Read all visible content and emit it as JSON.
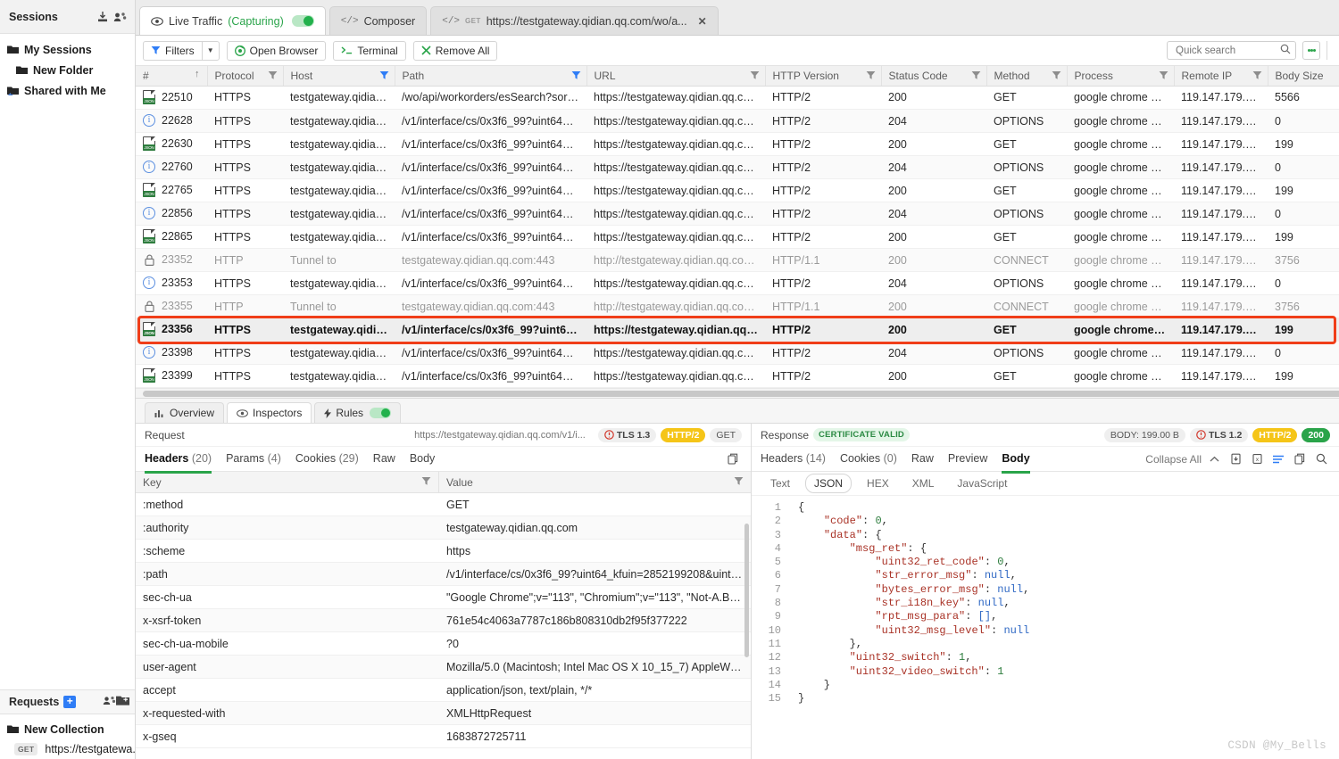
{
  "sidebar": {
    "header": {
      "title": "Sessions",
      "icons": [
        "import-icon",
        "manage-sessions-icon"
      ]
    },
    "items": [
      {
        "label": "My Sessions",
        "level": 1
      },
      {
        "label": "New Folder",
        "level": 2
      },
      {
        "label": "Shared with Me",
        "level": 1
      }
    ],
    "requests": {
      "title": "Requests",
      "add_label": "+",
      "icons": [
        "share-requests-icon",
        "new-folder-icon"
      ],
      "collection": "New Collection",
      "item_method": "GET",
      "item_label": "https://testgatewa..."
    }
  },
  "tabs": [
    {
      "label": "Live Traffic",
      "status": "(Capturing)",
      "icon": "eye-icon",
      "toggle": true,
      "active": true
    },
    {
      "label": "Composer",
      "icon": "code-icon",
      "active": false
    },
    {
      "label": "https://testgateway.qidian.qq.com/wo/a...",
      "icon": "code-icon",
      "method": "GET",
      "closable": true,
      "active": false
    }
  ],
  "toolbar": {
    "filters": "Filters",
    "open_browser": "Open Browser",
    "terminal": "Terminal",
    "remove_all": "Remove All",
    "search_placeholder": "Quick search",
    "search_value": ""
  },
  "traffic_table": {
    "columns": [
      "#",
      "Protocol",
      "Host",
      "Path",
      "URL",
      "HTTP Version",
      "Status Code",
      "Method",
      "Process",
      "Remote IP",
      "Body Size"
    ],
    "sort_column": "#",
    "sort_dir": "asc",
    "rows": [
      {
        "icon": "json-icon",
        "id": "22510",
        "protocol": "HTTPS",
        "host": "testgateway.qidian.q...",
        "path": "/wo/api/workorders/esSearch?sort=last...",
        "url": "https://testgateway.qidian.qq.com/wo/...",
        "version": "HTTP/2",
        "status": "200",
        "method": "GET",
        "process": "google chrome h:1601",
        "ip": "119.147.179.200",
        "size": "5566"
      },
      {
        "icon": "info-icon",
        "id": "22628",
        "protocol": "HTTPS",
        "host": "testgateway.qidian.q...",
        "path": "/v1/interface/cs/0x3f6_99?uint64_kfuin=...",
        "url": "https://testgateway.qidian.qq.com/v1/i...",
        "version": "HTTP/2",
        "status": "204",
        "method": "OPTIONS",
        "process": "google chrome h:1601",
        "ip": "119.147.179.200",
        "size": "0"
      },
      {
        "icon": "json-icon",
        "id": "22630",
        "protocol": "HTTPS",
        "host": "testgateway.qidian.q...",
        "path": "/v1/interface/cs/0x3f6_99?uint64_kfuin=...",
        "url": "https://testgateway.qidian.qq.com/v1/i...",
        "version": "HTTP/2",
        "status": "200",
        "method": "GET",
        "process": "google chrome h:1601",
        "ip": "119.147.179.200",
        "size": "199"
      },
      {
        "icon": "info-icon",
        "id": "22760",
        "protocol": "HTTPS",
        "host": "testgateway.qidian.q...",
        "path": "/v1/interface/cs/0x3f6_99?uint64_kfuin=...",
        "url": "https://testgateway.qidian.qq.com/v1/i...",
        "version": "HTTP/2",
        "status": "204",
        "method": "OPTIONS",
        "process": "google chrome h:1601",
        "ip": "119.147.179.200",
        "size": "0"
      },
      {
        "icon": "json-icon",
        "id": "22765",
        "protocol": "HTTPS",
        "host": "testgateway.qidian.q...",
        "path": "/v1/interface/cs/0x3f6_99?uint64_kfuin=...",
        "url": "https://testgateway.qidian.qq.com/v1/i...",
        "version": "HTTP/2",
        "status": "200",
        "method": "GET",
        "process": "google chrome h:1601",
        "ip": "119.147.179.200",
        "size": "199"
      },
      {
        "icon": "info-icon",
        "id": "22856",
        "protocol": "HTTPS",
        "host": "testgateway.qidian.q...",
        "path": "/v1/interface/cs/0x3f6_99?uint64_kfuin=...",
        "url": "https://testgateway.qidian.qq.com/v1/i...",
        "version": "HTTP/2",
        "status": "204",
        "method": "OPTIONS",
        "process": "google chrome h:1601",
        "ip": "119.147.179.200",
        "size": "0"
      },
      {
        "icon": "json-icon",
        "id": "22865",
        "protocol": "HTTPS",
        "host": "testgateway.qidian.q...",
        "path": "/v1/interface/cs/0x3f6_99?uint64_kfuin=...",
        "url": "https://testgateway.qidian.qq.com/v1/i...",
        "version": "HTTP/2",
        "status": "200",
        "method": "GET",
        "process": "google chrome h:1601",
        "ip": "119.147.179.200",
        "size": "199"
      },
      {
        "icon": "lock-icon",
        "id": "23352",
        "protocol": "HTTP",
        "host": "Tunnel to",
        "path": "testgateway.qidian.qq.com:443",
        "url": "http://testgateway.qidian.qq.com:443",
        "version": "HTTP/1.1",
        "status": "200",
        "method": "CONNECT",
        "process": "google chrome h:1601",
        "ip": "119.147.179.200",
        "size": "3756",
        "muted": true
      },
      {
        "icon": "info-icon",
        "id": "23353",
        "protocol": "HTTPS",
        "host": "testgateway.qidian.q...",
        "path": "/v1/interface/cs/0x3f6_99?uint64_kfuin=...",
        "url": "https://testgateway.qidian.qq.com/v1/i...",
        "version": "HTTP/2",
        "status": "204",
        "method": "OPTIONS",
        "process": "google chrome h:1601",
        "ip": "119.147.179.200",
        "size": "0"
      },
      {
        "icon": "lock-icon",
        "id": "23355",
        "protocol": "HTTP",
        "host": "Tunnel to",
        "path": "testgateway.qidian.qq.com:443",
        "url": "http://testgateway.qidian.qq.com:443",
        "version": "HTTP/1.1",
        "status": "200",
        "method": "CONNECT",
        "process": "google chrome h:1601",
        "ip": "119.147.179.200",
        "size": "3756",
        "muted": true
      },
      {
        "icon": "json-icon",
        "id": "23356",
        "protocol": "HTTPS",
        "host": "testgateway.qidian.q...",
        "path": "/v1/interface/cs/0x3f6_99?uint64_kfui...",
        "url": "https://testgateway.qidian.qq.com/v1/...",
        "version": "HTTP/2",
        "status": "200",
        "method": "GET",
        "process": "google chrome h:1601",
        "ip": "119.147.179.2...",
        "size": "199",
        "selected": true
      },
      {
        "icon": "info-icon",
        "id": "23398",
        "protocol": "HTTPS",
        "host": "testgateway.qidian.q...",
        "path": "/v1/interface/cs/0x3f6_99?uint64_kfuin=...",
        "url": "https://testgateway.qidian.qq.com/v1/i...",
        "version": "HTTP/2",
        "status": "204",
        "method": "OPTIONS",
        "process": "google chrome h:1601",
        "ip": "119.147.179.200",
        "size": "0"
      },
      {
        "icon": "json-icon",
        "id": "23399",
        "protocol": "HTTPS",
        "host": "testgateway.qidian.q...",
        "path": "/v1/interface/cs/0x3f6_99?uint64_kfuin=...",
        "url": "https://testgateway.qidian.qq.com/v1/i...",
        "version": "HTTP/2",
        "status": "200",
        "method": "GET",
        "process": "google chrome h:1601",
        "ip": "119.147.179.200",
        "size": "199"
      }
    ]
  },
  "bottom_tabs": [
    {
      "label": "Overview",
      "icon": "chart-icon",
      "active": false
    },
    {
      "label": "Inspectors",
      "icon": "eye-icon",
      "active": true
    },
    {
      "label": "Rules",
      "icon": "bolt-icon",
      "toggle": true,
      "active": false
    }
  ],
  "request_panel": {
    "title": "Request",
    "url": "https://testgateway.qidian.qq.com/v1/i...",
    "tls": "TLS 1.3",
    "http": "HTTP/2",
    "method": "GET",
    "tabs": [
      {
        "label": "Headers",
        "count": "(20)",
        "active": true
      },
      {
        "label": "Params",
        "count": "(4)",
        "active": false
      },
      {
        "label": "Cookies",
        "count": "(29)",
        "active": false
      },
      {
        "label": "Raw",
        "count": "",
        "active": false
      },
      {
        "label": "Body",
        "count": "",
        "active": false
      }
    ],
    "copy_icon": "copy-icon",
    "col_key": "Key",
    "col_value": "Value",
    "headers": [
      {
        "key": ":method",
        "value": "GET"
      },
      {
        "key": ":authority",
        "value": "testgateway.qidian.qq.com"
      },
      {
        "key": ":scheme",
        "value": "https"
      },
      {
        "key": ":path",
        "value": "/v1/interface/cs/0x3f6_99?uint64_kfuin=2852199208&uint64_kfex..."
      },
      {
        "key": "sec-ch-ua",
        "value": "\"Google Chrome\";v=\"113\", \"Chromium\";v=\"113\", \"Not-A.Brand\";v..."
      },
      {
        "key": "x-xsrf-token",
        "value": "761e54c4063a7787c186b808310db2f95f377222"
      },
      {
        "key": "sec-ch-ua-mobile",
        "value": "?0"
      },
      {
        "key": "user-agent",
        "value": "Mozilla/5.0 (Macintosh; Intel Mac OS X 10_15_7) AppleWebKit/537..."
      },
      {
        "key": "accept",
        "value": "application/json, text/plain, */*"
      },
      {
        "key": "x-requested-with",
        "value": "XMLHttpRequest"
      },
      {
        "key": "x-gseq",
        "value": "1683872725711"
      }
    ]
  },
  "response_panel": {
    "title": "Response",
    "certificate": "CERTIFICATE VALID",
    "body_size": "BODY: 199.00 B",
    "tls": "TLS 1.2",
    "http": "HTTP/2",
    "status": "200",
    "tabs": [
      {
        "label": "Headers",
        "count": "(14)",
        "active": false
      },
      {
        "label": "Cookies",
        "count": "(0)",
        "active": false
      },
      {
        "label": "Raw",
        "count": "",
        "active": false
      },
      {
        "label": "Preview",
        "count": "",
        "active": false
      },
      {
        "label": "Body",
        "count": "",
        "active": true
      }
    ],
    "collapse_all": "Collapse All",
    "action_icons": [
      "save-icon",
      "image-icon",
      "wrap-icon",
      "copy-icon",
      "search-icon"
    ],
    "formats": [
      "Text",
      "JSON",
      "HEX",
      "XML",
      "JavaScript"
    ],
    "active_format": "JSON",
    "code_lines": [
      {
        "n": 1,
        "indent": 0,
        "text": "{"
      },
      {
        "n": 2,
        "indent": 1,
        "key": "\"code\"",
        "value": "0",
        "vtype": "num",
        "comma": true
      },
      {
        "n": 3,
        "indent": 1,
        "key": "\"data\"",
        "value": "{",
        "vtype": "brace"
      },
      {
        "n": 4,
        "indent": 2,
        "key": "\"msg_ret\"",
        "value": "{",
        "vtype": "brace"
      },
      {
        "n": 5,
        "indent": 3,
        "key": "\"uint32_ret_code\"",
        "value": "0",
        "vtype": "num",
        "comma": true
      },
      {
        "n": 6,
        "indent": 3,
        "key": "\"str_error_msg\"",
        "value": "null",
        "vtype": "null",
        "comma": true
      },
      {
        "n": 7,
        "indent": 3,
        "key": "\"bytes_error_msg\"",
        "value": "null",
        "vtype": "null",
        "comma": true
      },
      {
        "n": 8,
        "indent": 3,
        "key": "\"str_i18n_key\"",
        "value": "null",
        "vtype": "null",
        "comma": true
      },
      {
        "n": 9,
        "indent": 3,
        "key": "\"rpt_msg_para\"",
        "value": "[]",
        "vtype": "null",
        "comma": true
      },
      {
        "n": 10,
        "indent": 3,
        "key": "\"uint32_msg_level\"",
        "value": "null",
        "vtype": "null"
      },
      {
        "n": 11,
        "indent": 2,
        "text": "},"
      },
      {
        "n": 12,
        "indent": 2,
        "key": "\"uint32_switch\"",
        "value": "1",
        "vtype": "num",
        "comma": true
      },
      {
        "n": 13,
        "indent": 2,
        "key": "\"uint32_video_switch\"",
        "value": "1",
        "vtype": "num"
      },
      {
        "n": 14,
        "indent": 1,
        "text": "}"
      },
      {
        "n": 15,
        "indent": 0,
        "text": "}"
      }
    ]
  },
  "watermark": "CSDN @My_Bells",
  "colors": {
    "accent_green": "#2aa44a",
    "highlight_red": "#f03e19",
    "http_yellow": "#f5c518",
    "link_blue": "#2f7df6"
  }
}
